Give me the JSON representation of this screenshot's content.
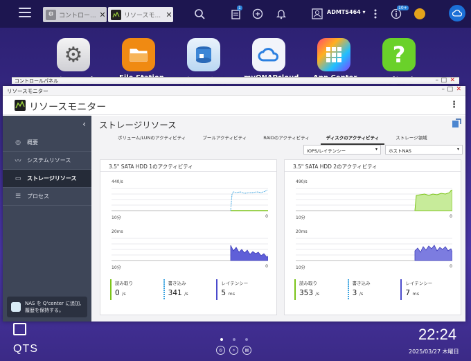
{
  "taskbar": {
    "tabs": [
      {
        "label": "コントロー...",
        "close": "✕"
      },
      {
        "label": "リソースモ...",
        "close": "✕"
      }
    ],
    "user": "ADMTS464",
    "badges": {
      "tasks": "1",
      "notices": "10+"
    },
    "user_caret": "▾"
  },
  "desktop": {
    "icons": [
      {
        "label": "コントロールパ",
        "icon": "gear-icon"
      },
      {
        "label": "File Station",
        "icon": "folder-icon"
      },
      {
        "label": "ストレージ&ス",
        "icon": "storage-icon"
      },
      {
        "label": "myQNAPcloud",
        "icon": "cloud-icon"
      },
      {
        "label": "App Center",
        "icon": "grid-icon"
      },
      {
        "label": "ヘルプセンター",
        "icon": "help-icon"
      }
    ],
    "qts": "QTS",
    "time": "22:24",
    "date": "2025/03/27 木曜日",
    "help_glyph": "?"
  },
  "control_panel_window": {
    "title": "コントロールパネル",
    "controls": [
      "–",
      "□",
      "✕"
    ]
  },
  "window": {
    "title": "リソースモニター",
    "controls": [
      "–",
      "□",
      "✕"
    ],
    "app_title": "リソースモニター",
    "menu_glyph": "⋮"
  },
  "sidebar": {
    "collapse_glyph": "‹",
    "items": [
      {
        "label": "概要",
        "icon": "dashboard-icon",
        "glyph": "◎"
      },
      {
        "label": "システムリソース",
        "icon": "chart-line-icon",
        "glyph": "〰"
      },
      {
        "label": "ストレージリソース",
        "icon": "hdd-icon",
        "glyph": "▭"
      },
      {
        "label": "プロセス",
        "icon": "list-icon",
        "glyph": "☰"
      }
    ],
    "qcenter_text_1": "NAS を Q'center に追加,",
    "qcenter_text_2": "履歴を保持する。"
  },
  "main": {
    "title": "ストレージリソース",
    "subtabs": [
      "ボリューム/LUNのアクティビティ",
      "プールアクティビティ",
      "RAIDのアクティビティ",
      "ディスクのアクティビティ",
      "ストレージ領域"
    ],
    "select_metric": "IOPS/レイテンシー",
    "select_target": "ホストNAS",
    "select_caret": "▾"
  },
  "cards": [
    {
      "title": "3.5\" SATA HDD 1のアクティビティ",
      "iops_ymax": "440/s",
      "lat_ymax": "20ms",
      "x_start": "10分",
      "x_end": "0",
      "read_label": "読み取り",
      "read_value": "0",
      "read_unit": "/s",
      "write_label": "書き込み",
      "write_value": "341",
      "write_unit": "/s",
      "latency_label": "レイテンシー",
      "latency_value": "5",
      "latency_unit": "ms"
    },
    {
      "title": "3.5\" SATA HDD 2のアクティビティ",
      "iops_ymax": "490/s",
      "lat_ymax": "20ms",
      "x_start": "10分",
      "x_end": "0",
      "read_label": "読み取り",
      "read_value": "353",
      "read_unit": "/s",
      "write_label": "書き込み",
      "write_value": "3",
      "write_unit": "/s",
      "latency_label": "レイテンシー",
      "latency_value": "7",
      "latency_unit": "ms"
    }
  ],
  "colors": {
    "read": "#7bc418",
    "write": "#3aa3e0",
    "latency": "#4b4bcc",
    "sidebar": "#3e4658",
    "taskbar": "#1d1650"
  }
}
